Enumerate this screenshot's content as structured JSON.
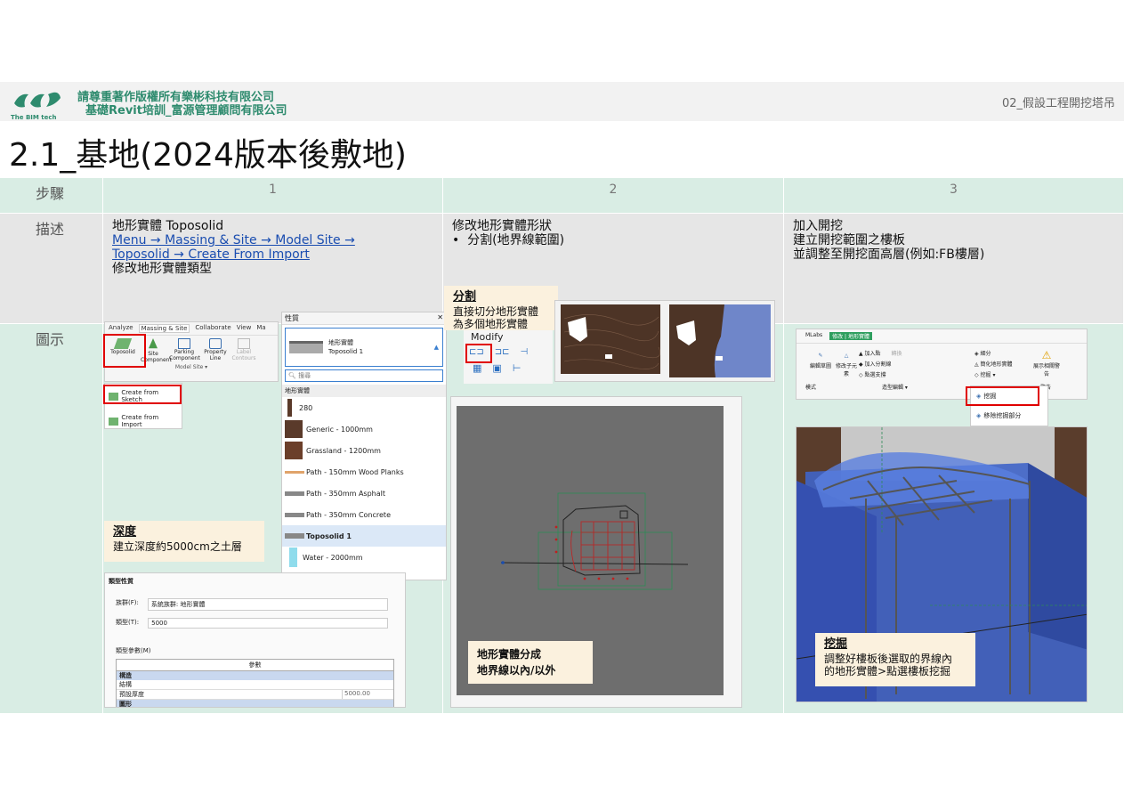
{
  "header": {
    "company_line1": "請尊重著作版權所有樂彬科技有限公司",
    "company_line2": "基礎Revit培訓_富源管理顧問有限公司",
    "logo_text": "The BIM tech",
    "chapter": "02_假設工程開挖塔吊"
  },
  "title": "2.1_基地(2024版本後敷地)",
  "table": {
    "row_labels": {
      "step": "步驟",
      "desc": "描述",
      "figure": "圖示"
    },
    "columns": [
      "1",
      "2",
      "3"
    ],
    "col1": {
      "line1": "地形實體 Toposolid",
      "link1": "Menu → Massing & Site → Model Site →",
      "link2": "Toposolid → Create From Import",
      "line4": "修改地形實體類型"
    },
    "col2": {
      "line1": "修改地形實體形狀",
      "bullet": "分割(地界線範圍)"
    },
    "col3": {
      "line1": "加入開挖",
      "line2": "建立開挖範圍之樓板",
      "line3": "並調整至開挖面高層(例如:FB樓層)"
    }
  },
  "fig1": {
    "ribbon_tabs": [
      "Analyze",
      "Massing & Site",
      "Collaborate",
      "View",
      "Ma"
    ],
    "ribbon_items": [
      "Toposolid",
      "Site Component",
      "Parking Component",
      "Property Line",
      "Label Contours"
    ],
    "panel_name": "Model Site ▾",
    "menu_items": [
      "Create from Sketch",
      "Create from Import"
    ],
    "props_title": "性質",
    "props_close": "✕",
    "type_name_1": "地形實體",
    "type_name_2": "Toposolid 1",
    "search_placeholder": "搜尋",
    "group": "地形實體",
    "types": [
      "280",
      "Generic - 1000mm",
      "Grassland - 1200mm",
      "Path - 150mm Wood Planks",
      "Path - 350mm Asphalt",
      "Path - 350mm Concrete",
      "Toposolid 1",
      "Water - 2000mm"
    ],
    "note_title": "深度",
    "note_text": "建立深度約5000cm之土層",
    "tp_title": "類型性質",
    "tp_family_label": "族群(F):",
    "tp_family_value": "系統族群: 地形實體",
    "tp_type_label": "類型(T):",
    "tp_type_value": "5000",
    "tp_params_label": "類型參數(M)",
    "tp_col_param": "參數",
    "tp_section": "構造",
    "tp_row1": "結構",
    "tp_row2": "預設厚度",
    "tp_row2_value": "5000.00",
    "tp_section2": "圖形"
  },
  "fig2": {
    "note_title": "分割",
    "note_line1": "直接切分地形實體",
    "note_line2": "為多個地形實體",
    "modify_label": "Modify",
    "bottom_note_line1": "地形實體分成",
    "bottom_note_line2": "地界線以內/以外"
  },
  "fig3": {
    "tabs": [
      "MLabs",
      "修改 | 地形實體"
    ],
    "tools": [
      "加入點",
      "加入分割線",
      "點選支撐",
      "轉換",
      "細分",
      "簡化地形實體",
      "挖掘 ▾",
      "展示相關警告"
    ],
    "groups": [
      "模式",
      "造型編輯 ▾",
      "警告"
    ],
    "left_tools": [
      "編輯草圖",
      "修改子元素"
    ],
    "dropdown_items": [
      "挖掘",
      "移除挖掘部分"
    ],
    "note_title": "挖掘",
    "note_line1": "調整好樓板後選取的界線內",
    "note_line2": "的地形實體>點選樓板挖掘"
  },
  "colors": {
    "accent_green": "#2e8b6e",
    "row_green": "#d9ede4",
    "row_grey": "#e6e6e6",
    "highlight_red": "#e00000",
    "note_bg": "#fbf1de"
  }
}
